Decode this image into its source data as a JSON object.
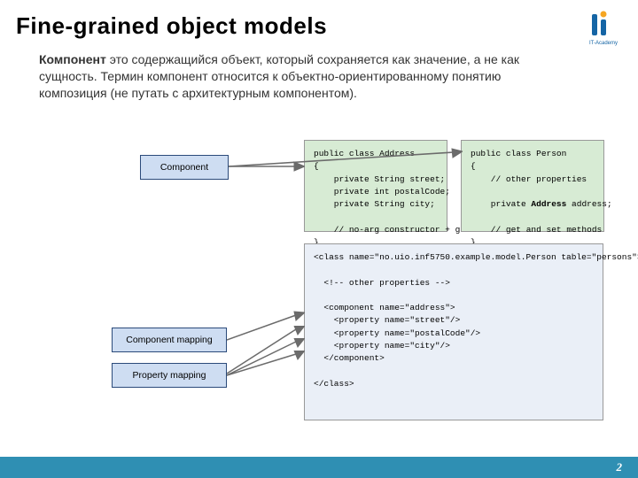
{
  "title": "Fine-grained object models",
  "logo_text": "IT-Academy",
  "paragraph": {
    "bold": "Компонент",
    "rest": " это содержащийся объект, который сохраняется как значение, а не как сущность. Термин компонент относится к объектно-ориентированному понятию композиция (не путать с архитектурным компонентом)."
  },
  "labels": {
    "component": "Component",
    "component_mapping": "Component mapping",
    "property_mapping": "Property mapping"
  },
  "code": {
    "address": "public class Address\n{\n    private String street;\n    private int postalCode;\n    private String city;\n\n    // no-arg constructor + get/set\n}",
    "person": "public class Person\n{\n    // other properties\n\n    private Address address;\n\n    // get and set methods\n}",
    "mapping": "<class name=\"no.uio.inf5750.example.model.Person table=\"persons\">\n\n  <!-- other properties -->\n\n  <component name=\"address\">\n    <property name=\"street\"/>\n    <property name=\"postalCode\"/>\n    <property name=\"city\"/>\n  </component>\n\n</class>"
  },
  "page_number": "2"
}
